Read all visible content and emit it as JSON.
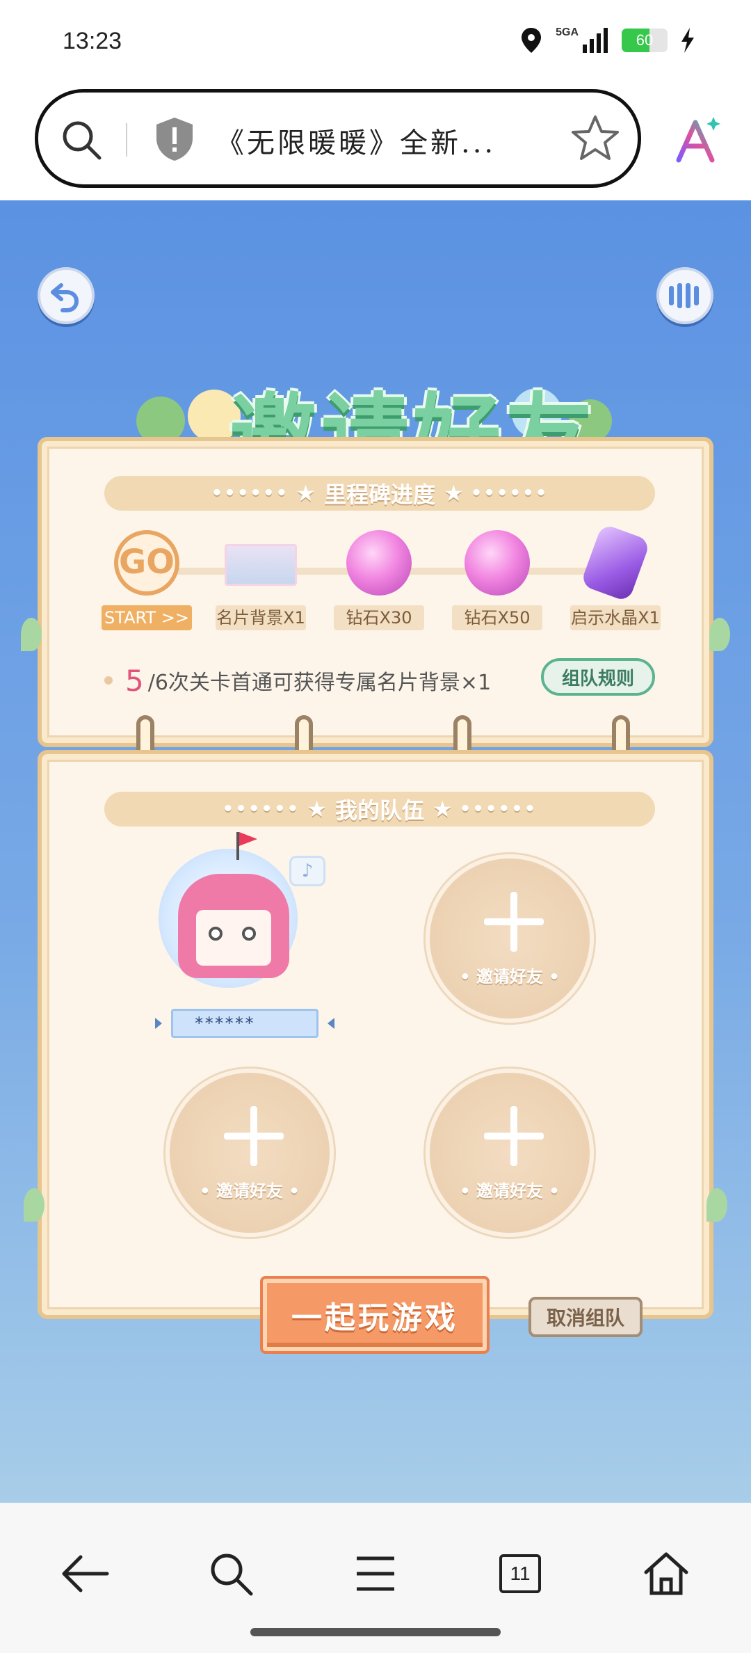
{
  "status_bar": {
    "time": "13:23",
    "network": "5GA",
    "battery": "60",
    "battery_level": 0.6,
    "icons": [
      "location-icon",
      "signal-icon",
      "battery-icon",
      "charging-icon"
    ]
  },
  "browser": {
    "page_title": "《无限暖暖》全新...",
    "icons": [
      "search-icon",
      "shield-icon",
      "star-icon",
      "ai-assistant-icon"
    ]
  },
  "page": {
    "banner_title": "邀请好友",
    "milestones": {
      "header": "里程碑进度",
      "header_dots": "••••••",
      "go_badge": "GO",
      "items": [
        {
          "label": "START >>"
        },
        {
          "label": "名片背景X1"
        },
        {
          "label": "钻石X30"
        },
        {
          "label": "钻石X50"
        },
        {
          "label": "启示水晶X1"
        }
      ],
      "progress_count": "5",
      "progress_text": "/6次关卡首通可获得专属名片背景×1",
      "rules_button": "组队规则"
    },
    "team": {
      "header": "我的队伍",
      "header_dots": "••••••",
      "member_name": "******",
      "invite_label": "• 邀请好友 •",
      "note_glyph": "♪"
    },
    "play_button": "一起玩游戏",
    "cancel_button": "取消组队"
  },
  "bottom_nav": {
    "tabs_count": "11",
    "items": [
      "back-arrow-icon",
      "search-icon",
      "menu-icon",
      "tabs-icon",
      "home-icon"
    ]
  },
  "colors": {
    "sky_top": "#5b92e2",
    "title_green": "#7bd0a1",
    "card_bg": "#fdf5ea",
    "accent_orange": "#f59a66",
    "accent_pink": "#e2527b"
  }
}
